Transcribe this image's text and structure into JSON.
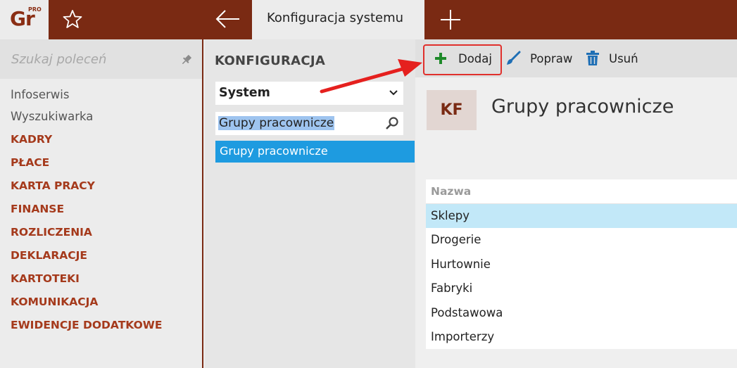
{
  "app": {
    "logo_text": "Gr",
    "logo_sup": "PRO",
    "active_tab": "Konfiguracja systemu"
  },
  "sidebar": {
    "search_placeholder": "Szukaj poleceń",
    "items": [
      {
        "label": "Infoserwis",
        "kind": "plain"
      },
      {
        "label": "Wyszukiwarka",
        "kind": "plain"
      },
      {
        "label": "KADRY",
        "kind": "cat"
      },
      {
        "label": "PŁACE",
        "kind": "cat"
      },
      {
        "label": "KARTA PRACY",
        "kind": "cat"
      },
      {
        "label": "FINANSE",
        "kind": "cat"
      },
      {
        "label": "ROZLICZENIA",
        "kind": "cat"
      },
      {
        "label": "DEKLARACJE",
        "kind": "cat"
      },
      {
        "label": "KARTOTEKI",
        "kind": "cat"
      },
      {
        "label": "KOMUNIKACJA",
        "kind": "cat"
      },
      {
        "label": "EWIDENCJE DODATKOWE",
        "kind": "cat"
      }
    ]
  },
  "config": {
    "title": "KONFIGURACJA",
    "selected_group": "System",
    "search_value": "Grupy pracownicze",
    "result_selected": "Grupy pracownicze"
  },
  "toolbar": {
    "add_label": "Dodaj",
    "edit_label": "Popraw",
    "delete_label": "Usuń"
  },
  "main": {
    "badge": "KF",
    "title": "Grupy pracownicze",
    "column_header": "Nazwa",
    "rows": [
      "Sklepy",
      "Drogerie",
      "Hurtownie",
      "Fabryki",
      "Podstawowa",
      "Importerzy"
    ],
    "selected_row": 0
  },
  "colors": {
    "brand": "#7a2a13",
    "category_text": "#a53a1c",
    "selection_blue": "#1e9be0",
    "row_highlight": "#c2e8f8",
    "add_icon": "#1f8a2a",
    "highlight_red": "#e0302c"
  },
  "icons": [
    "star-icon",
    "back-arrow-icon",
    "plus-icon",
    "pin-icon",
    "chevron-down-icon",
    "search-icon",
    "add-icon",
    "brush-icon",
    "trash-icon"
  ]
}
